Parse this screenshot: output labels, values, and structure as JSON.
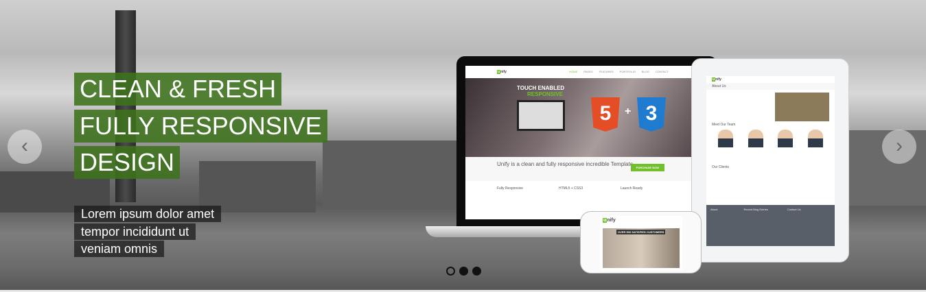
{
  "slider": {
    "captions": [
      "CLEAN & FRESH",
      "FULLY RESPONSIVE",
      "DESIGN"
    ],
    "subtext": [
      "Lorem ipsum dolor amet",
      "tempor incididunt ut",
      "veniam omnis"
    ],
    "prev_icon": "chevron-left-icon",
    "next_icon": "chevron-right-icon",
    "prev_glyph": "‹",
    "next_glyph": "›",
    "slides_total": 3,
    "active_slide": 1,
    "accent_color": "#3e731e"
  },
  "mockup": {
    "logo_u": "u",
    "logo_rest": "nify",
    "nav": [
      "HOME",
      "PAGES",
      "FEATURES",
      "PORTFOLIO",
      "BLOG",
      "CONTACT"
    ],
    "hero_line1": "TOUCH ENABLED",
    "hero_line2": "RESPONSIVE",
    "html5": "5",
    "css3": "3",
    "plus": "+",
    "tagline": "Unify is a clean and fully responsive incredible Template.",
    "purchase": "PURCHASE NOW",
    "features": [
      "Fully Responsive",
      "HTML5 + CSS3",
      "Launch Ready"
    ],
    "tablet": {
      "about": "About Us",
      "team": "Meet Our Team",
      "clients": "Our Clients",
      "footer": [
        "About",
        "Recent Blog Entries",
        "Contact Us"
      ]
    },
    "phone_banner": "OVER 500 SATISFIED CUSTOMERS"
  }
}
